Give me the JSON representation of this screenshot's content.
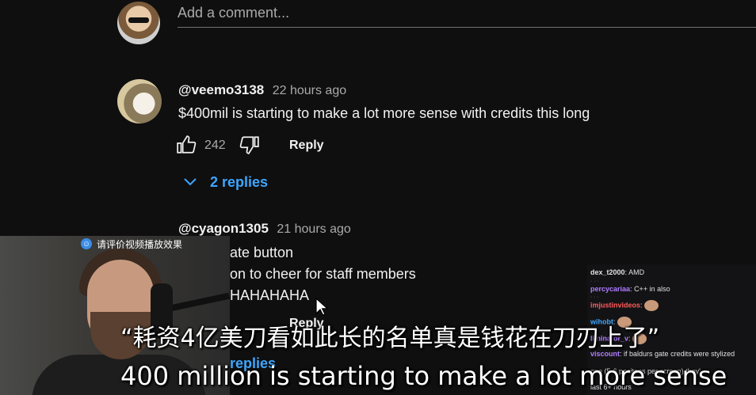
{
  "add_comment": {
    "placeholder": "Add a comment..."
  },
  "comments": [
    {
      "username": "@veemo3138",
      "time": "22 hours ago",
      "text": "$400mil is starting to make a lot more sense with credits this long",
      "likes": "242",
      "reply_label": "Reply",
      "replies_label": "2 replies"
    },
    {
      "username": "@cyagon1305",
      "time": "21 hours ago",
      "lines": [
        "ate button",
        "on to cheer for staff members",
        "HAHAHAHA"
      ],
      "reply_label": "Reply",
      "replies_label": "replies"
    }
  ],
  "overlay": {
    "eval_badge": "请评价视频播放效果",
    "subtitle_cn": "“耗资4亿美刀看如此长的名单真是钱花在刀刃上了”",
    "subtitle_en": "400 million is starting to make a lot more sense"
  },
  "chat": [
    {
      "name": "dex_t2000",
      "text": "AMD",
      "color": "#f1f1f1"
    },
    {
      "name": "percycariaa",
      "text": "C++ in also",
      "color": "#9b59f5"
    },
    {
      "name": "imjustinvideos",
      "text": "",
      "color": "#ff5c5c"
    },
    {
      "name": "wihobt",
      "text": "",
      "color": "#3ea6ff"
    },
    {
      "name": "liminator_v",
      "text": "",
      "color": "#9b59f5"
    },
    {
      "name": "viscount",
      "text": "if baldurs gate credits were stylized",
      "color": "#b07cff"
    },
    {
      "name": "",
      "text": "one (5-6 positons per screen) they'",
      "color": "#e0e0e0"
    },
    {
      "name": "",
      "text": "last 6+ hours",
      "color": "#e0e0e0"
    }
  ]
}
